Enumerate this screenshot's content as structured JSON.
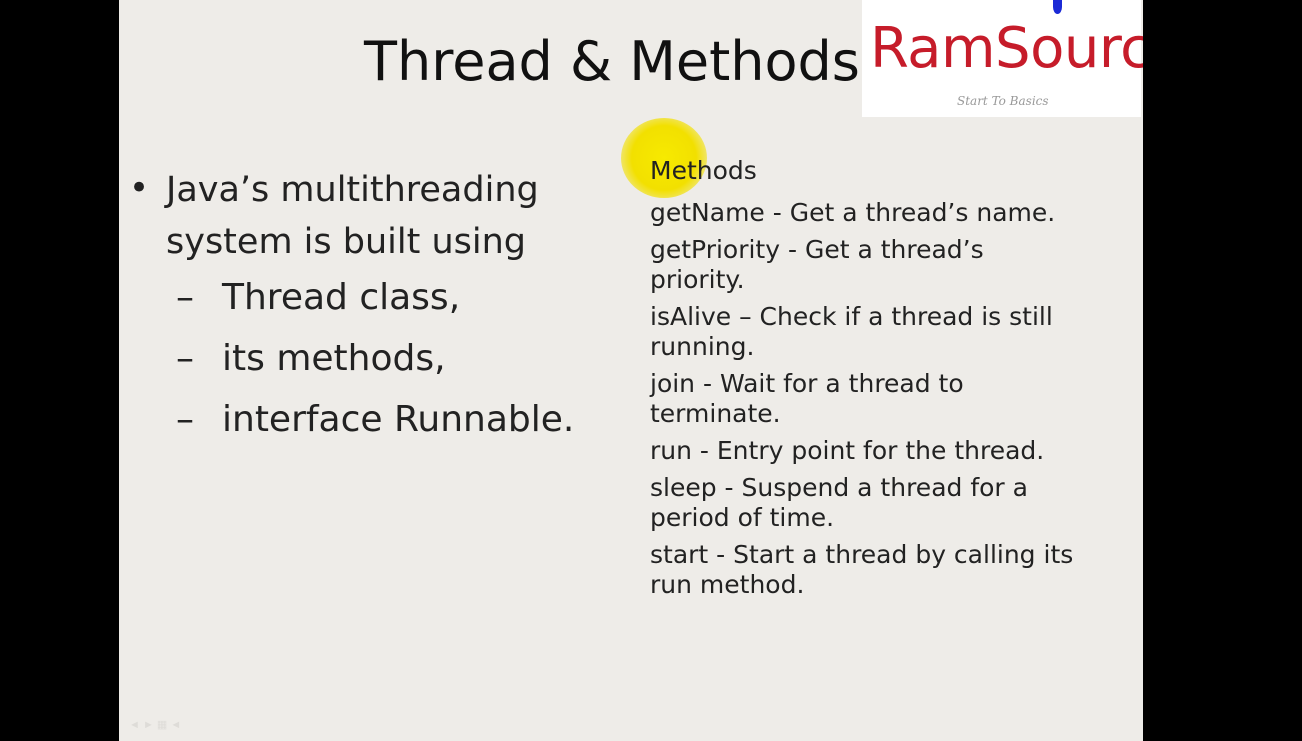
{
  "slide": {
    "title": "Thread & Methods",
    "logo": {
      "name": "RamSource",
      "tagline": "Start To Basics"
    },
    "left": {
      "bullet": "Java’s multithreading system is built using",
      "sub_items": [
        "Thread class,",
        "its methods,",
        "interface  Runnable."
      ],
      "dash": "–",
      "bullet_char": "•"
    },
    "right": {
      "heading": "Methods",
      "methods": [
        "getName - Get a thread’s name.",
        "getPriority - Get a thread’s priority.",
        "isAlive – Check if a thread is still running.",
        "join - Wait for a thread to terminate.",
        "run -  Entry point for the thread.",
        "sleep - Suspend a thread for a period of time.",
        "start - Start a thread by calling its run method."
      ]
    },
    "footer": "◄ ► ▦ ◄"
  },
  "colors": {
    "background_outer": "#000000",
    "slide_background": "#eeece8",
    "logo_text": "#c61c2a",
    "highlight": "#f2e000"
  },
  "icons": [
    "logo-drop-icon",
    "cursor-highlight"
  ]
}
